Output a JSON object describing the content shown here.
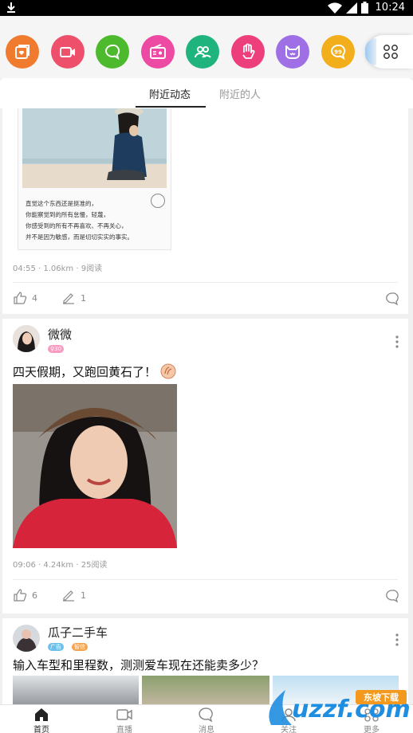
{
  "status_bar": {
    "time": "10:24"
  },
  "app_icons": [
    {
      "name": "photo-album-icon",
      "color": "#f07a2e"
    },
    {
      "name": "video-camera-icon",
      "color": "#ee4f6a"
    },
    {
      "name": "chat-bubble-icon",
      "color": "#4cba2c"
    },
    {
      "name": "radio-icon",
      "color": "#ec4aa3"
    },
    {
      "name": "group-icon",
      "color": "#1fb47d"
    },
    {
      "name": "hand-wave-icon",
      "color": "#ee3f7d"
    },
    {
      "name": "cat-face-icon",
      "color": "#9f6fe6"
    },
    {
      "name": "jiujiu-99-icon",
      "color": "#f3ae1c",
      "label": "99"
    }
  ],
  "tabs": {
    "nearby_posts": "附近动态",
    "nearby_people": "附近的人"
  },
  "posts": [
    {
      "image_caption": [
        "直觉这个东西还是挺准的，",
        "你能察觉到的所有怠慢，轻蔑，",
        "你感受到的所有不再喜欢、不再关心，",
        "并不是因为敏感，而是切切实实的事实。"
      ],
      "time": "04:55",
      "distance": "1.06km",
      "reads": "9阅读",
      "likes": "4",
      "comments": "1"
    },
    {
      "username": "微微",
      "badge": "♀30",
      "text": "四天假期，又跑回黄石了！",
      "time": "09:06",
      "distance": "4.24km",
      "reads": "25阅读",
      "likes": "6",
      "comments": "1"
    },
    {
      "username": "瓜子二手车",
      "badges": [
        "广告",
        "智信"
      ],
      "text": "输入车型和里程数，测测爱车现在还能卖多少？"
    }
  ],
  "bottom_nav": [
    {
      "label": "首页",
      "icon": "home-icon",
      "active": true
    },
    {
      "label": "直播",
      "icon": "live-video-icon"
    },
    {
      "label": "消息",
      "icon": "message-icon"
    },
    {
      "label": "关注",
      "icon": "follow-icon"
    },
    {
      "label": "更多",
      "icon": "more-icon"
    }
  ],
  "watermark": {
    "logo": "uzzf.com",
    "tag": "东坡下载"
  },
  "colors": {
    "female_badge": "#f79bc0",
    "ad_badge": "#6dc0ec",
    "smart_badge": "#f5a44c"
  }
}
